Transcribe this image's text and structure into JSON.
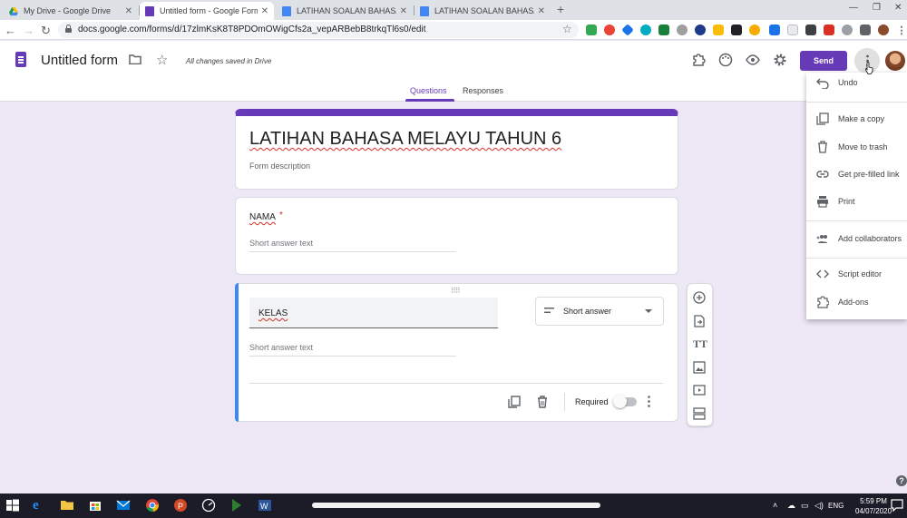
{
  "browser": {
    "tabs": [
      {
        "title": "My Drive - Google Drive",
        "active": false
      },
      {
        "title": "Untitled form - Google Forms",
        "active": true
      },
      {
        "title": "LATIHAN SOALAN BAHASA MEL",
        "active": false
      },
      {
        "title": "LATIHAN SOALAN BAHASA MEL",
        "active": false
      }
    ],
    "new_tab": "+",
    "url": "docs.google.com/forms/d/17zlmKsK8T8PDOmOWigCfs2a_vepARBebB8trkqTl6s0/edit"
  },
  "header": {
    "doc_title": "Untitled form",
    "saved_status": "All changes saved in Drive",
    "send_label": "Send"
  },
  "form_tabs": {
    "questions": "Questions",
    "responses": "Responses"
  },
  "form": {
    "title": "LATIHAN BAHASA MELAYU TAHUN 6",
    "description_placeholder": "Form description"
  },
  "questions": [
    {
      "title": "NAMA",
      "required_mark": "*",
      "answer_hint": "Short answer text"
    },
    {
      "title": "KELAS",
      "type": "Short answer",
      "answer_hint": "Short answer text",
      "required_label": "Required",
      "required": false
    }
  ],
  "menu": {
    "items": [
      {
        "label": "Undo",
        "icon": "undo-icon"
      },
      {
        "label": "Make a copy",
        "icon": "copy-icon"
      },
      {
        "label": "Move to trash",
        "icon": "trash-icon"
      },
      {
        "label": "Get pre-filled link",
        "icon": "link-icon"
      },
      {
        "label": "Print",
        "icon": "print-icon"
      },
      {
        "label": "Add collaborators",
        "icon": "add-people-icon"
      },
      {
        "label": "Script editor",
        "icon": "code-icon"
      },
      {
        "label": "Add-ons",
        "icon": "puzzle-icon"
      }
    ]
  },
  "taskbar": {
    "time": "5:59 PM",
    "date": "04/07/2020",
    "language": "ENG"
  },
  "colors": {
    "accent": "#673ab7",
    "background": "#ede7f6",
    "active_question_bar": "#4285f4"
  }
}
